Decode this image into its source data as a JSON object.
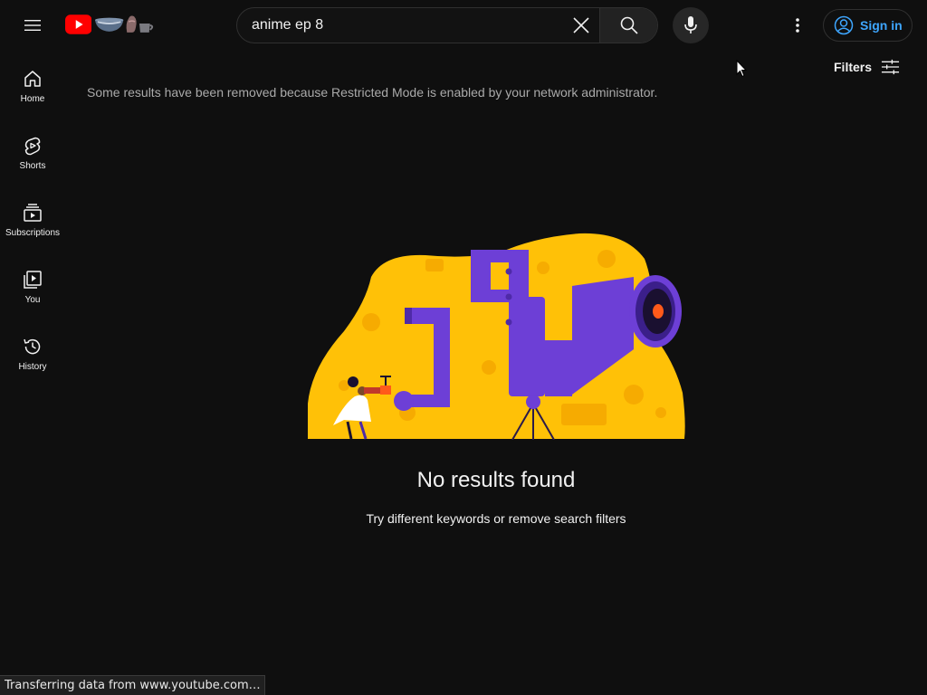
{
  "header": {
    "search_value": "anime ep 8",
    "signin_label": "Sign in"
  },
  "guide": {
    "items": [
      {
        "label": "Home",
        "icon": "home-icon"
      },
      {
        "label": "Shorts",
        "icon": "shorts-icon"
      },
      {
        "label": "Subscriptions",
        "icon": "subscriptions-icon"
      },
      {
        "label": "You",
        "icon": "you-icon"
      },
      {
        "label": "History",
        "icon": "history-icon"
      }
    ]
  },
  "main": {
    "filters_label": "Filters",
    "restricted_message": "Some results have been removed because Restricted Mode is enabled by your network administrator.",
    "no_results_title": "No results found",
    "no_results_subtitle": "Try different keywords or remove search filters"
  },
  "status_bar": {
    "text": "Transferring data from www.youtube.com…"
  },
  "colors": {
    "background": "#0f0f0f",
    "brand_red": "#ff0000",
    "link_blue": "#3ea6ff",
    "illustration_yellow": "#ffc107",
    "illustration_purple": "#6d3fd6"
  }
}
